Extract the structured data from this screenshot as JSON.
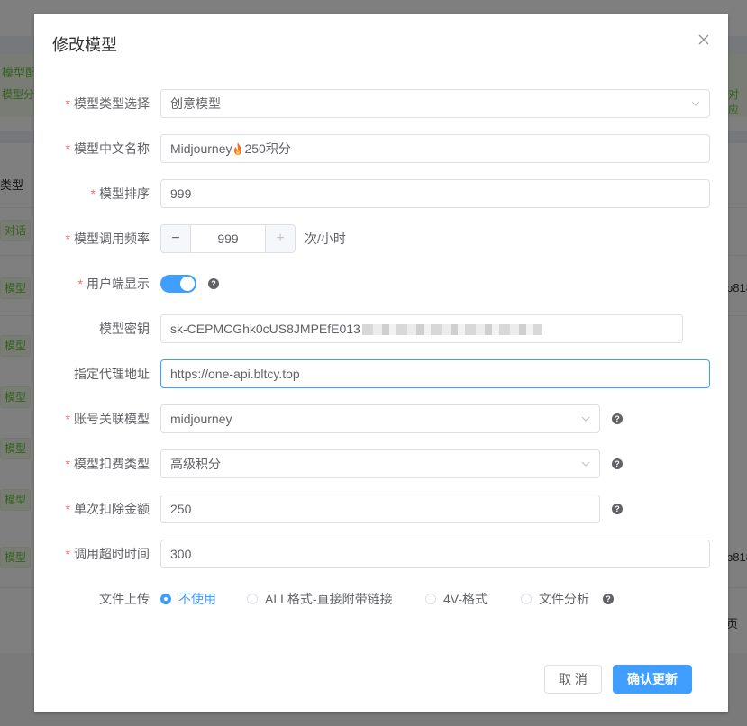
{
  "background": {
    "band_top": "模型配",
    "band_sub": "模型分",
    "band_right": "对应",
    "col_header": "类型",
    "tags": [
      "对话",
      "模型",
      "模型",
      "模型",
      "模型",
      "模型",
      "模型"
    ],
    "right_text_1": "b818",
    "right_text_2": "b818",
    "right_text_3": "页"
  },
  "dialog": {
    "title": "修改模型",
    "close_icon": "close-icon",
    "fields": {
      "model_type": {
        "label": "模型类型选择",
        "value": "创意模型",
        "required": true
      },
      "model_name": {
        "label": "模型中文名称",
        "value_prefix": "Midjourney",
        "value_suffix": "250积分",
        "required": true
      },
      "model_order": {
        "label": "模型排序",
        "value": "999",
        "required": true
      },
      "call_freq": {
        "label": "模型调用频率",
        "value": "999",
        "unit": "次/小时",
        "required": true
      },
      "user_display": {
        "label": "用户端显示",
        "enabled": true,
        "required": true
      },
      "model_key": {
        "label": "模型密钥",
        "value": "sk-CEPMCGhk0cUS8JMPEfE013"
      },
      "proxy_url": {
        "label": "指定代理地址",
        "value": "https://one-api.bltcy.top"
      },
      "linked_model": {
        "label": "账号关联模型",
        "value": "midjourney",
        "required": true
      },
      "deduct_type": {
        "label": "模型扣费类型",
        "value": "高级积分",
        "required": true
      },
      "deduct_amount": {
        "label": "单次扣除金额",
        "value": "250",
        "required": true
      },
      "timeout": {
        "label": "调用超时时间",
        "value": "300",
        "required": true
      },
      "file_upload": {
        "label": "文件上传",
        "options": [
          "不使用",
          "ALL格式-直接附带链接",
          "4V-格式",
          "文件分析"
        ],
        "selected": "不使用"
      }
    },
    "footer": {
      "cancel_label": "取 消",
      "confirm_label": "确认更新"
    }
  },
  "colors": {
    "primary": "#409eff",
    "required": "#f56c6c",
    "border": "#dcdfe6",
    "flame": "#f56c2a"
  }
}
